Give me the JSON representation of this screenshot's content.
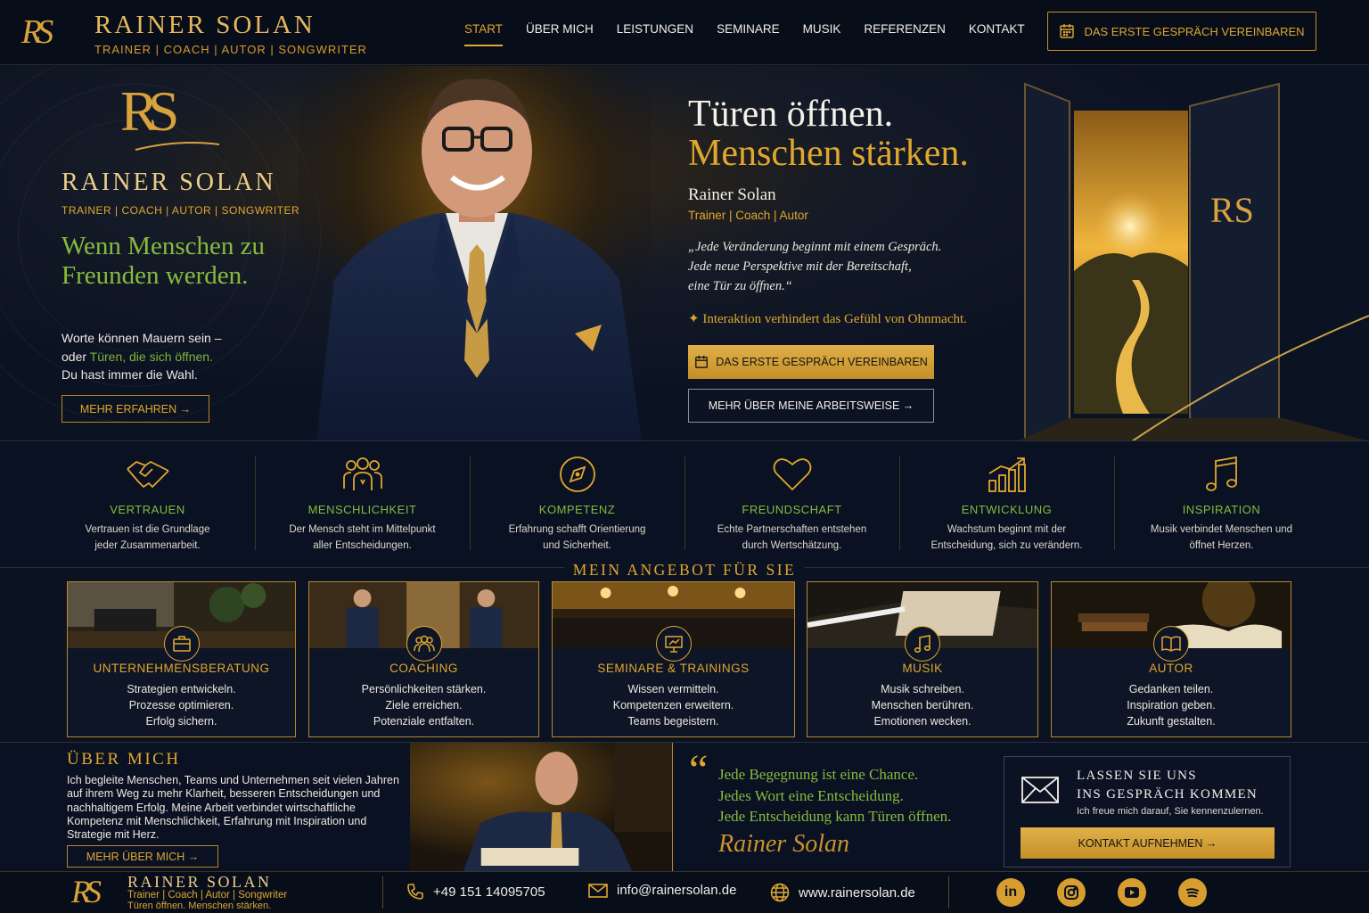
{
  "header": {
    "logo": "RS",
    "brand": "RAINER SOLAN",
    "tagline": "TRAINER | COACH | AUTOR | SONGWRITER",
    "nav": [
      "START",
      "ÜBER MICH",
      "LEISTUNGEN",
      "SEMINARE",
      "MUSIK",
      "REFERENZEN",
      "KONTAKT"
    ],
    "active_nav": "START",
    "cta": "DAS ERSTE GESPRÄCH VEREINBAREN"
  },
  "hero": {
    "logo": "RS",
    "name": "RAINER SOLAN",
    "tagline": "TRAINER | COACH | AUTOR | SONGWRITER",
    "slogan": "Wenn Menschen zu Freunden werden.",
    "sub_line1": "Worte können Mauern sein –",
    "sub_line2_a": "oder ",
    "sub_line2_b": "Türen, die sich öffnen.",
    "sub_line3": "Du hast immer die Wahl.",
    "more_button": "MEHR ERFAHREN →",
    "headline_1": "Türen öffnen.",
    "headline_2": "Menschen stärken.",
    "person_name": "Rainer Solan",
    "person_role": "Trainer | Coach | Autor",
    "quote_1": "„Jede Veränderung beginnt mit einem Gespräch.",
    "quote_2": "Jede neue Perspektive mit der Bereitschaft,",
    "quote_3": "eine Tür zu öffnen.“",
    "note": "✦ Interaktion verhindert das Gefühl von Ohnmacht.",
    "cta_primary": "DAS ERSTE GESPRÄCH VEREINBAREN",
    "cta_secondary": "MEHR ÜBER MEINE ARBEITSWEISE →",
    "door_monogram": "RS"
  },
  "values": [
    {
      "icon": "handshake-icon",
      "title": "VERTRAUEN",
      "l1": "Vertrauen ist die Grundlage",
      "l2": "jeder Zusammenarbeit."
    },
    {
      "icon": "people-icon",
      "title": "MENSCHLICHKEIT",
      "l1": "Der Mensch steht im Mittelpunkt",
      "l2": "aller Entscheidungen."
    },
    {
      "icon": "compass-icon",
      "title": "KOMPETENZ",
      "l1": "Erfahrung schafft Orientierung",
      "l2": "und Sicherheit."
    },
    {
      "icon": "heart-icon",
      "title": "FREUNDSCHAFT",
      "l1": "Echte Partnerschaften entstehen",
      "l2": "durch Wertschätzung."
    },
    {
      "icon": "growth-chart-icon",
      "title": "ENTWICKLUNG",
      "l1": "Wachstum beginnt mit der",
      "l2": "Entscheidung, sich zu verändern."
    },
    {
      "icon": "music-note-icon",
      "title": "INSPIRATION",
      "l1": "Musik verbindet Menschen und",
      "l2": "öffnet Herzen."
    }
  ],
  "offer": {
    "title": "MEIN ANGEBOT FÜR SIE",
    "cards": [
      {
        "icon": "briefcase-icon",
        "title": "UNTERNEHMENSBERATUNG",
        "l1": "Strategien entwickeln.",
        "l2": "Prozesse optimieren.",
        "l3": "Erfolg sichern."
      },
      {
        "icon": "group-icon",
        "title": "COACHING",
        "l1": "Persönlichkeiten stärken.",
        "l2": "Ziele erreichen.",
        "l3": "Potenziale entfalten."
      },
      {
        "icon": "presentation-icon",
        "title": "SEMINARE & TRAININGS",
        "l1": "Wissen vermitteln.",
        "l2": "Kompetenzen erweitern.",
        "l3": "Teams begeistern."
      },
      {
        "icon": "music-note-icon",
        "title": "MUSIK",
        "l1": "Musik schreiben.",
        "l2": "Menschen berühren.",
        "l3": "Emotionen wecken."
      },
      {
        "icon": "book-icon",
        "title": "AUTOR",
        "l1": "Gedanken teilen.",
        "l2": "Inspiration geben.",
        "l3": "Zukunft gestalten."
      }
    ]
  },
  "about": {
    "title": "ÜBER MICH",
    "text": "Ich begleite Menschen, Teams und Unternehmen seit vielen Jahren auf ihrem Weg zu mehr Klarheit, besseren Entscheidungen und nachhaltigem Erfolg. Meine Arbeit verbindet wirtschaftliche Kompetenz mit Menschlichkeit, Erfahrung mit Inspiration und Strategie mit Herz.",
    "more_button": "MEHR ÜBER MICH →",
    "quote_mark": "“",
    "quote_1": "Jede Begegnung ist eine Chance.",
    "quote_2": "Jedes Wort eine Entscheidung.",
    "quote_3": "Jede Entscheidung kann Türen öffnen.",
    "signature": "Rainer Solan"
  },
  "contact_box": {
    "title_1": "LASSEN SIE UNS",
    "title_2": "INS GESPRÄCH KOMMEN",
    "sub": "Ich freue mich darauf, Sie kennenzulernen.",
    "button": "KONTAKT AUFNEHMEN →"
  },
  "footer": {
    "logo": "RS",
    "name": "RAINER SOLAN",
    "tagline": "Trainer | Coach | Autor | Songwriter",
    "slogan": "Türen öffnen. Menschen stärken.",
    "phone": "+49 151 14095705",
    "email": "info@rainersolan.de",
    "web": "www.rainersolan.de",
    "social": [
      "linkedin-icon",
      "instagram-icon",
      "youtube-icon",
      "spotify-icon"
    ]
  },
  "colors": {
    "gold": "#e0a72e",
    "green": "#86bb3e",
    "navy": "#0a1120"
  }
}
